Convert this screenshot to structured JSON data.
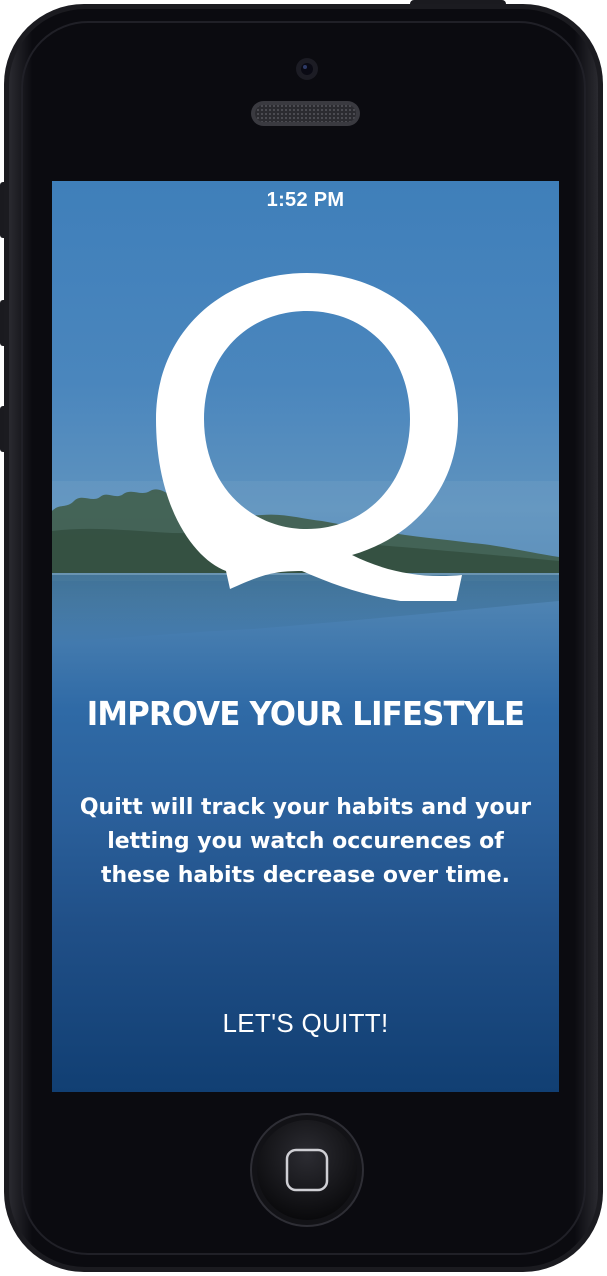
{
  "status_bar": {
    "time": "1:52 PM"
  },
  "logo": {
    "letter": "Q"
  },
  "headline": "IMPROVE YOUR LIFESTYLE",
  "description": {
    "lines": [
      "Quitt will track your habits and your",
      "letting you watch occurences of",
      "these habits decrease over time."
    ]
  },
  "cta": {
    "label": "LET'S QUITT!"
  },
  "colors": {
    "sky_top": "#3f7fba",
    "water_bottom": "#113f73",
    "text": "#ffffff",
    "phone_body": "#0a0a0f"
  }
}
